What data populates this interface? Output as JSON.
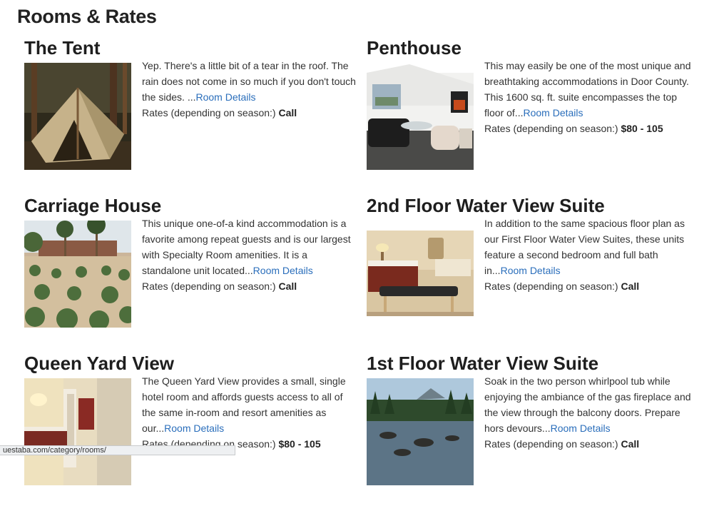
{
  "page": {
    "title": "Rooms & Rates"
  },
  "rates_label": "Rates (depending on season:)",
  "rooms": [
    {
      "name": "The Tent",
      "description": "Yep. There's a little bit of a tear in the roof. The rain does not come in so much if you don't touch the sides. ...",
      "link": "Room Details",
      "rate": "Call"
    },
    {
      "name": "Penthouse",
      "description": "This may easily be one of the most unique and breathtaking accommodations in Door County. This 1600 sq. ft. suite encompasses the top floor of...",
      "link": "Room Details",
      "rate": "$80 - 105"
    },
    {
      "name": "Carriage House",
      "description": "This unique one-of-a kind accommodation is a favorite among repeat guests and is our largest with Specialty Room amenities. It is a standalone unit located...",
      "link": "Room Details",
      "rate": "Call"
    },
    {
      "name": "2nd Floor Water View Suite",
      "description": "In addition to the same spacious floor plan as our First Floor Water View Suites, these units feature a second bedroom and full bath in...",
      "link": "Room Details",
      "rate": "Call"
    },
    {
      "name": "Queen Yard View",
      "description": "The Queen Yard View provides a small, single hotel room and affords guests access to all of the same in-room and resort amenities as our...",
      "link": "Room Details",
      "rate": "$80 - 105"
    },
    {
      "name": "1st Floor Water View Suite",
      "description": "Soak in the two person whirlpool tub while enjoying the ambiance of the gas fireplace and the view through the balcony doors. Prepare hors devours...",
      "link": "Room Details",
      "rate": "Call"
    }
  ],
  "status_bar": {
    "url": "uestaba.com/category/rooms/"
  }
}
